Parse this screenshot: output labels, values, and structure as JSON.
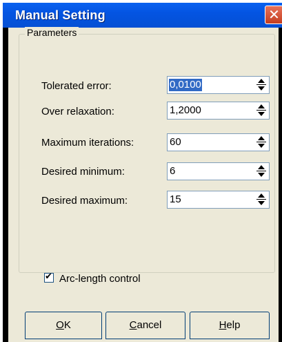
{
  "window": {
    "title": "Manual Setting",
    "close_glyph": "✕"
  },
  "group": {
    "label": "Parameters"
  },
  "params": [
    {
      "label": "Tolerated error:",
      "value": "0,0100",
      "selected": true
    },
    {
      "label": "Over relaxation:",
      "value": "1,2000",
      "selected": false
    },
    {
      "label": "Maximum iterations:",
      "value": "60",
      "selected": false
    },
    {
      "label": "Desired minimum:",
      "value": "6",
      "selected": false
    },
    {
      "label": "Desired maximum:",
      "value": "15",
      "selected": false
    }
  ],
  "checkbox": {
    "label": "Arc-length control",
    "checked": true,
    "mark": "✔"
  },
  "buttons": {
    "ok": {
      "underline": "O",
      "rest": "K"
    },
    "cancel": {
      "underline": "C",
      "rest": "ancel"
    },
    "help": {
      "underline": "H",
      "rest": "elp"
    }
  },
  "colors": {
    "titlebar": "#0454e2",
    "client_bg": "#ece9d8",
    "selection": "#316ac5",
    "close_button": "#c43d1f"
  }
}
